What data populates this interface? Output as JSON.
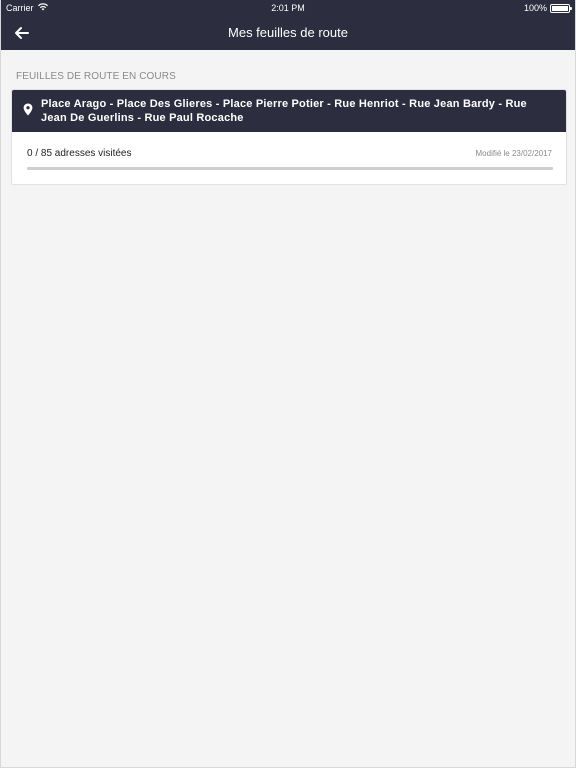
{
  "status_bar": {
    "carrier": "Carrier",
    "time": "2:01 PM",
    "battery": "100%",
    "battery_level": 1.0
  },
  "nav": {
    "title": "Mes feuilles de route",
    "back_icon": "arrow-left-icon"
  },
  "section": {
    "header": "FEUILLES DE ROUTE EN COURS"
  },
  "route_card": {
    "icon": "map-pin-icon",
    "title": "Place Arago - Place Des Glieres - Place Pierre Potier - Rue Henriot - Rue Jean Bardy - Rue Jean De Guerlins - Rue Paul Rocache",
    "visited_text": "0 / 85 adresses visitées",
    "modified_text": "Modifié le 23/02/2017",
    "progress": 0
  },
  "colors": {
    "primary": "#2c2d3e",
    "background": "#f4f4f4",
    "progress_track": "#cfcfcf"
  }
}
